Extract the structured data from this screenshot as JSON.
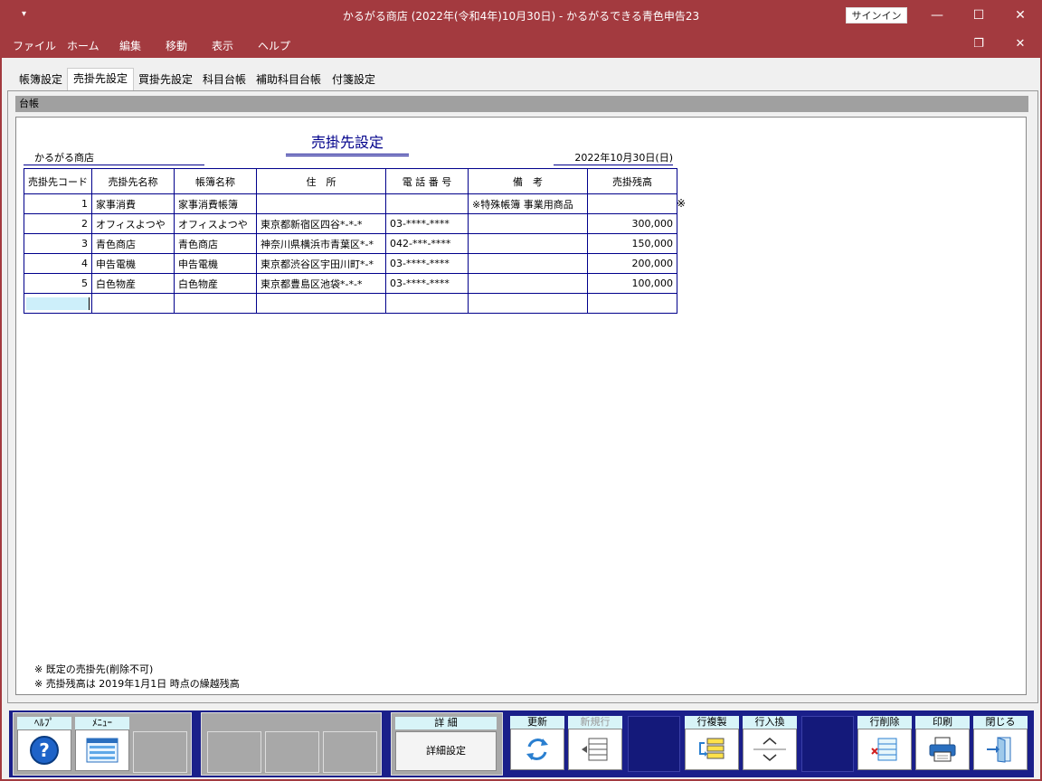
{
  "window": {
    "title": "かるがる商店 (2022年(令和4年)10月30日)  -  かるがるできる青色申告23",
    "signin": "サインイン",
    "qa_icon": "▾",
    "controls": {
      "minimize": "—",
      "maximize": "☐",
      "close": "✕",
      "restore": "❐"
    }
  },
  "menu": [
    "ファイル",
    "ホーム",
    "編集",
    "移動",
    "表示",
    "ヘルプ"
  ],
  "tabs": [
    "帳簿設定",
    "売掛先設定",
    "買掛先設定",
    "科目台帳",
    "補助科目台帳",
    "付箋設定"
  ],
  "active_tab": "売掛先設定",
  "ledger_bar": "台帳",
  "sheet": {
    "title": "売掛先設定",
    "shop": "かるがる商店",
    "date": "2022年10月30日(日)",
    "mark": "※",
    "columns": [
      "売掛先コード",
      "売掛先名称",
      "帳簿名称",
      "住　所",
      "電 話 番 号",
      "備　考",
      "売掛残高"
    ],
    "rows": [
      {
        "code": "1",
        "name": "家事消費",
        "book": "家事消費帳簿",
        "address": "",
        "phone": "",
        "note": "※特殊帳簿  事業用商品",
        "balance": ""
      },
      {
        "code": "2",
        "name": "オフィスよつや",
        "book": "オフィスよつや",
        "address": "東京都新宿区四谷*-*-*",
        "phone": "03-****-****",
        "note": "",
        "balance": "300,000"
      },
      {
        "code": "3",
        "name": "青色商店",
        "book": "青色商店",
        "address": "神奈川県横浜市青葉区*-*",
        "phone": "042-***-****",
        "note": "",
        "balance": "150,000"
      },
      {
        "code": "4",
        "name": "申告電機",
        "book": "申告電機",
        "address": "東京都渋谷区宇田川町*-*",
        "phone": "03-****-****",
        "note": "",
        "balance": "200,000"
      },
      {
        "code": "5",
        "name": "白色物産",
        "book": "白色物産",
        "address": "東京都豊島区池袋*-*-*",
        "phone": "03-****-****",
        "note": "",
        "balance": "100,000"
      }
    ],
    "notes": [
      "※ 既定の売掛先(削除不可)",
      "※ 売掛残高は 2019年1月1日 時点の繰越残高"
    ]
  },
  "bottom": {
    "help": "ﾍﾙﾌﾟ",
    "menu": "ﾒﾆｭｰ",
    "detail_label": "詳 細",
    "detail_button": "詳細設定",
    "update": "更新",
    "new_row": "新規行",
    "copy_row": "行複製",
    "swap_row": "行入換",
    "delete_row": "行削除",
    "print": "印刷",
    "close": "閉じる"
  },
  "colors": {
    "titlebar": "#a33a3f",
    "grid_line": "#00008b",
    "bottombar": "#1a1f8a",
    "key_label": "#d8f4f8"
  }
}
